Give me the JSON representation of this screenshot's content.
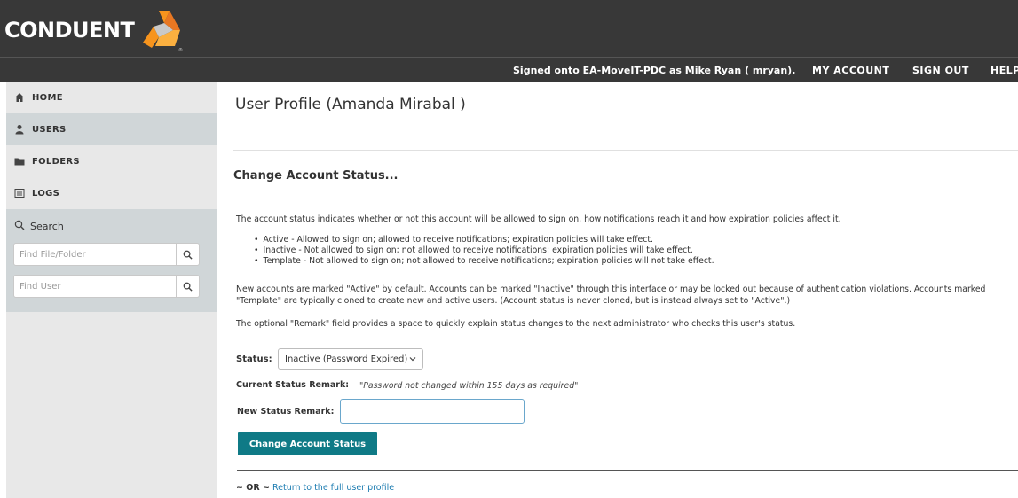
{
  "header": {
    "logo_text": "CONDUENT",
    "signed_on_text": "Signed onto EA-MoveIT-PDC as Mike Ryan ( mryan).",
    "nav": {
      "my_account": "MY ACCOUNT",
      "sign_out": "SIGN OUT",
      "help": "HELP"
    }
  },
  "sidebar": {
    "items": [
      {
        "label": "HOME",
        "icon": "home-icon"
      },
      {
        "label": "USERS",
        "icon": "user-icon"
      },
      {
        "label": "FOLDERS",
        "icon": "folder-icon"
      },
      {
        "label": "LOGS",
        "icon": "list-icon"
      }
    ],
    "search": {
      "title": "Search",
      "find_file_placeholder": "Find File/Folder",
      "find_user_placeholder": "Find User"
    }
  },
  "main": {
    "page_title": "User Profile (Amanda Mirabal )",
    "section_title": "Change Account Status...",
    "intro": "The account status indicates whether or not this account will be allowed to sign on, how notifications reach it and how expiration policies affect it.",
    "bullets": [
      "Active - Allowed to sign on; allowed to receive notifications; expiration policies will take effect.",
      "Inactive - Not allowed to sign on; not allowed to receive notifications; expiration policies will take effect.",
      "Template - Not allowed to sign on; not allowed to receive notifications; expiration policies will not take effect."
    ],
    "default_note": "New accounts are marked \"Active\" by default. Accounts can be marked \"Inactive\" through this interface or may be locked out because of authentication violations. Accounts marked \"Template\" are typically cloned to create new and active users. (Account status is never cloned, but is instead always set to \"Active\".)",
    "remark_note": "The optional \"Remark\" field provides a space to quickly explain status changes to the next administrator who checks this user's status.",
    "status_label": "Status:",
    "status_value": "Inactive (Password Expired)",
    "current_remark_label": "Current Status Remark:",
    "current_remark_value": "\"Password not changed within 155 days as required\"",
    "new_remark_label": "New Status Remark:",
    "new_remark_value": "",
    "change_button": "Change Account Status",
    "or_text": "~ OR ~",
    "return_link": "Return to the full user profile"
  },
  "colors": {
    "header_bg": "#383838",
    "sidebar_active_bg": "#d0d6d8",
    "sidebar_bg": "#e8e8e8",
    "button_bg": "#0f7a86",
    "link": "#1b7bb0",
    "logo_orange": "#f7941d"
  }
}
